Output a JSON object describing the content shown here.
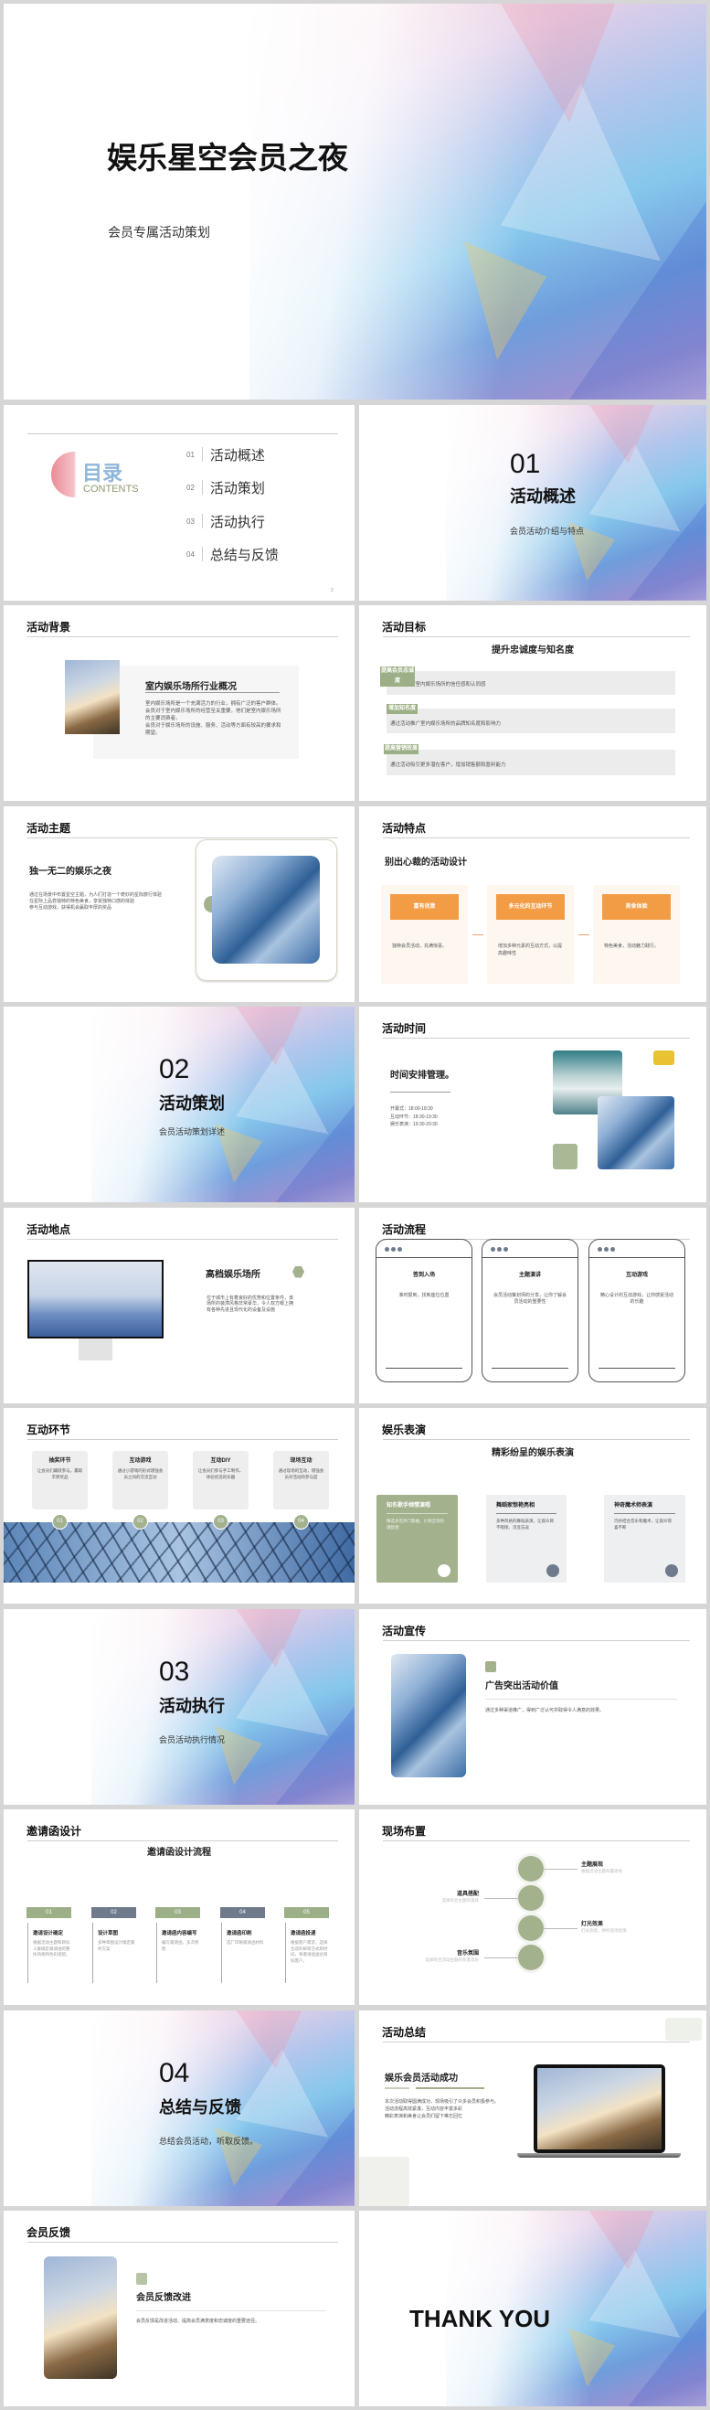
{
  "cover": {
    "title": "娱乐星空会员之夜",
    "subtitle": "会员专属活动策划"
  },
  "toc": {
    "title": "目录",
    "subtitle": "CONTENTS",
    "page": "2",
    "items": [
      {
        "num": "01",
        "label": "活动概述"
      },
      {
        "num": "02",
        "label": "活动策划"
      },
      {
        "num": "03",
        "label": "活动执行"
      },
      {
        "num": "04",
        "label": "总结与反馈"
      }
    ]
  },
  "sections": [
    {
      "num": "01",
      "title": "活动概述",
      "subtitle": "会员活动介绍与特点"
    },
    {
      "num": "02",
      "title": "活动策划",
      "subtitle": "会员活动策划详述"
    },
    {
      "num": "03",
      "title": "活动执行",
      "subtitle": "会员活动执行情况"
    },
    {
      "num": "04",
      "title": "总结与反馈",
      "subtitle": "总结会员活动，听取反馈。"
    }
  ],
  "background": {
    "header": "活动背景",
    "card_title": "室内娱乐场所行业概况",
    "lines": [
      "室内娱乐场所是一个充满活力的行业，拥有广泛的客户群体。",
      "会员对于室内娱乐场所的经营至关重要，他们是室内娱乐场所的主要消费者。",
      "会员对于娱乐场所的设施、服务、活动等方面有较高的要求和期望。"
    ]
  },
  "goals": {
    "header": "活动目标",
    "subtitle": "提升忠诚度与知名度",
    "items": [
      {
        "badge": "提高会员忠诚度",
        "text": "增强会员对室内娱乐场所的信任感和认同感"
      },
      {
        "badge": "增加知名度",
        "text": "通过活动推广室内娱乐场所的品牌知名度和影响力"
      },
      {
        "badge": "提高营销效果",
        "text": "通过活动吸引更多潜在客户，增加销售额和盈利能力"
      }
    ]
  },
  "theme": {
    "header": "活动主题",
    "subtitle": "独一无二的娱乐之夜",
    "lines": [
      "通过在场景中布置星空主题，为人们打造一个奇妙的星际旅行体验",
      "在星际上品尝独特的特色美食，享受独特口感的体验",
      "参与互动游戏，获得机会赢取丰厚的奖品"
    ]
  },
  "features": {
    "header": "活动特点",
    "subtitle": "别出心裁的活动设计",
    "cards": [
      {
        "title": "富有创意",
        "text": "独特会员活动，充满惊喜。"
      },
      {
        "title": "多元化的互动环节",
        "text": "增加多种元素的互动方式，以提高趣味性"
      },
      {
        "title": "美食体验",
        "text": "特色美食，活动魅力践行。"
      }
    ],
    "accent": "#f29d45"
  },
  "time": {
    "header": "活动时间",
    "subtitle": "时间安排管理。",
    "schedule": [
      "开幕式：18:00-18:30",
      "互动环节：18:30-19:30",
      "娱乐表演：19:30-20:30"
    ]
  },
  "venue": {
    "header": "活动地点",
    "title": "高档娱乐场所",
    "text": "位于城市上有着良好的优势和位置条件，该场所的装潢风格非常豪华，令人双方眼上拥有各种先进且现代化的设备及设施"
  },
  "flow": {
    "header": "活动流程",
    "cards": [
      {
        "title": "签到入场",
        "text": "准时报到，找到座位位置"
      },
      {
        "title": "主题演讲",
        "text": "会员活动策划师的分享，让你了解会员活动的重要性"
      },
      {
        "title": "互动游戏",
        "text": "精心设计的互动游戏，让你感受活动的乐趣"
      }
    ]
  },
  "interact": {
    "header": "互动环节",
    "cards": [
      {
        "num": "01",
        "title": "抽奖环节",
        "text": "让会员们踊跃参与，赢取丰厚奖品"
      },
      {
        "num": "02",
        "title": "互动游戏",
        "text": "通过小游戏的形式增强会员之间的交流互动"
      },
      {
        "num": "03",
        "title": "互动DIY",
        "text": "让会员们参与手工制作，体验创造的乐趣"
      },
      {
        "num": "04",
        "title": "现场互动",
        "text": "通过现场的互动，增强会员对活动的参与度"
      }
    ]
  },
  "shows": {
    "header": "娱乐表演",
    "subtitle": "精彩纷呈的娱乐表演",
    "cards": [
      {
        "title": "知名歌手倾情演唱",
        "text": "精选多首热门歌曲，引领全场热潮氛围",
        "icon": "document-icon"
      },
      {
        "title": "舞蹈家惊艳亮相",
        "text": "多种风格的舞蹈表演，让观众目不暇接、流连忘返",
        "icon": "building-icon"
      },
      {
        "title": "神奇魔术师表演",
        "text": "巧妙结合音乐和魔术，让观众惊喜不断",
        "icon": "image-icon"
      }
    ]
  },
  "promo": {
    "header": "活动宣传",
    "title": "广告突出活动价值",
    "text": "通过多种渠道推广，得到广泛认可并取得令人满意的效果。"
  },
  "invite": {
    "header": "邀请函设计",
    "subtitle": "邀请函设计流程",
    "steps": [
      {
        "num": "01",
        "title": "邀请设计确定",
        "text": "根据活动主题和目标人群确定邀请函的整体风格和色彩搭配。"
      },
      {
        "num": "02",
        "title": "设计草图",
        "text": "多种草图设计确定最终方案"
      },
      {
        "num": "03",
        "title": "邀请函内容编写",
        "text": "编写邀请函，多次修改"
      },
      {
        "num": "04",
        "title": "邀请函印刷",
        "text": "选厂印刷邀请函材料"
      },
      {
        "num": "05",
        "title": "邀请函投递",
        "text": "根据客户需求，选择合适的邮寄方式和时间，将邀请函送达目标客户。"
      }
    ]
  },
  "layout": {
    "header": "现场布置",
    "items": [
      {
        "title": "主题展现",
        "text": "根据活动主题布置场地"
      },
      {
        "title": "道具搭配",
        "text": "选择符合主题的道具"
      },
      {
        "title": "灯光效果",
        "text": "灯光氛围，烘托现场氛围"
      },
      {
        "title": "音乐氛围",
        "text": "选择符合活动主题的背景音乐"
      }
    ]
  },
  "summary": {
    "header": "活动总结",
    "title": "娱乐会员活动成功",
    "lines": [
      "本次活动取得圆满成功，现场吸引了众多会员积极参与。",
      "活动流程高效紧凑，互动内容丰富多彩",
      "精彩表演和美食让会员们留下难忘回忆"
    ]
  },
  "feedback": {
    "header": "会员反馈",
    "title": "会员反馈改进",
    "text": "会员反馈是改进活动、提高会员满意度和忠诚度的重要途径。"
  },
  "thanks": {
    "text": "THANK YOU"
  },
  "colors": {
    "green": "#9daf86",
    "orange": "#f29d45",
    "slate": "#6f7a8c",
    "yellow": "#e8c232"
  }
}
